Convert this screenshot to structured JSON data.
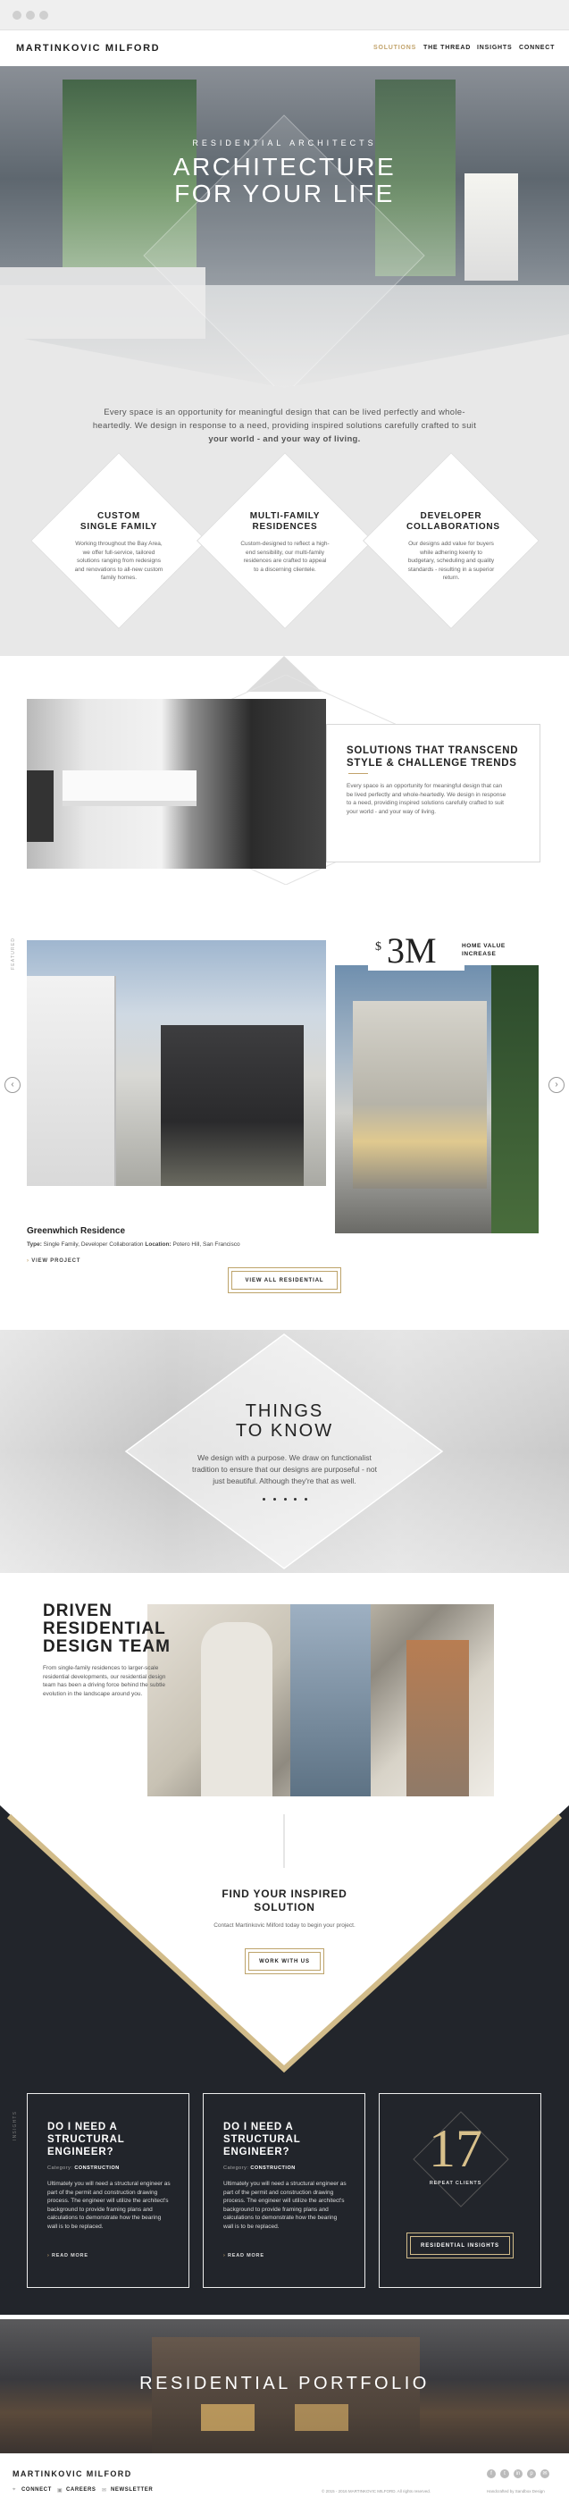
{
  "nav": {
    "logo": "MARTINKOVIC MILFORD",
    "items": [
      "SOLUTIONS",
      "THE THREAD",
      "INSIGHTS",
      "CONNECT"
    ],
    "active_color": "#c2a36b"
  },
  "hero": {
    "eyebrow": "RESIDENTIAL ARCHITECTS",
    "title_line1": "ARCHITECTURE",
    "title_line2": "FOR YOUR LIFE"
  },
  "intro": {
    "text": "Every space is an opportunity for meaningful design that can be lived perfectly and whole-heartedly. We design in response to a need, providing inspired solutions carefully crafted to suit",
    "emphasis": "your world - and your way of living."
  },
  "services": [
    {
      "title_line1": "CUSTOM",
      "title_line2": "SINGLE FAMILY",
      "text": "Working throughout the Bay Area, we offer full-service, tailored solutions ranging from redesigns and renovations to all-new custom family homes."
    },
    {
      "title_line1": "MULTI-FAMILY",
      "title_line2": "RESIDENCES",
      "text": "Custom-designed to reflect a high-end sensibility, our multi-family residences are crafted to appeal to a discerning clientele."
    },
    {
      "title_line1": "DEVELOPER",
      "title_line2": "COLLABORATIONS",
      "text": "Our designs add value for buyers while adhering keenly to budgetary, scheduling and quality standards - resulting in a superior return."
    }
  ],
  "trends": {
    "title_line1": "SOLUTIONS THAT TRANSCEND",
    "title_line2": "STYLE & CHALLENGE TRENDS",
    "text": "Every space is an opportunity for meaningful design that can be lived perfectly and whole-heartedly. We design in response to a need, providing inspired solutions carefully crafted to suit your world - and your way of living."
  },
  "featured": {
    "side_label": "FEATURED",
    "stat_symbol": "$",
    "stat_value": "3M",
    "stat_label_line1": "HOME VALUE",
    "stat_label_line2": "INCREASE",
    "project_name": "Greenwhich Residence",
    "type_label": "Type:",
    "type_value": "Single Family, Developer Collaboration",
    "location_label": "Location:",
    "location_value": "Potero Hill, San Francisco",
    "view_project": "VIEW PROJECT",
    "view_all": "VIEW ALL RESIDENTIAL",
    "prev_icon": "‹",
    "next_icon": "›"
  },
  "things": {
    "title_line1": "THINGS",
    "title_line2": "TO KNOW",
    "text": "We design with a purpose. We draw on functionalist tradition to ensure that our designs are purposeful - not just beautiful. Although they're that as well."
  },
  "team": {
    "title_line1": "DRIVEN",
    "title_line2": "RESIDENTIAL",
    "title_line3": "DESIGN TEAM",
    "text": "From single-family residences to larger-scale residential developments, our residential design team has been a driving force behind the subtle evolution in the landscape around you."
  },
  "inspire": {
    "title_line1": "FIND YOUR INSPIRED",
    "title_line2": "SOLUTION",
    "text": "Contact Martinkovic Milford today to begin your project.",
    "button": "WORK WITH US"
  },
  "insights": {
    "side_label": "INSIGHTS",
    "cards": [
      {
        "title_line1": "DO I NEED A",
        "title_line2": "STRUCTURAL",
        "title_line3": "ENGINEER?",
        "category_label": "Category:",
        "category": "CONSTRUCTION",
        "text": "Ultimately you will need a structural engineer as part of the permit and construction drawing process. The engineer will utilize the architect's background to provide framing plans and calculations to demonstrate how the bearing wall is to be replaced.",
        "more": "READ MORE"
      },
      {
        "title_line1": "DO I NEED A",
        "title_line2": "STRUCTURAL",
        "title_line3": "ENGINEER?",
        "category_label": "Category:",
        "category": "CONSTRUCTION",
        "text": "Ultimately you will need a structural engineer as part of the permit and construction drawing process. The engineer will utilize the architect's background to provide framing plans and calculations to demonstrate how the bearing wall is to be replaced.",
        "more": "READ MORE"
      }
    ],
    "stat_value": "17",
    "stat_label": "REPEAT CLIENTS",
    "button": "RESIDENTIAL INSIGHTS"
  },
  "portfolio": {
    "title": "RESIDENTIAL PORTFOLIO"
  },
  "footer": {
    "logo": "MARTINKOVIC MILFORD",
    "links": [
      "CONNECT",
      "CAREERS",
      "NEWSLETTER"
    ],
    "social": [
      "f",
      "t",
      "in",
      "p",
      "✉"
    ],
    "copyright": "© 2015 - 2016 MARTINKOVIC MILFORD. All rights reserved.",
    "credit": "Handcrafted by Sandbox Design"
  }
}
